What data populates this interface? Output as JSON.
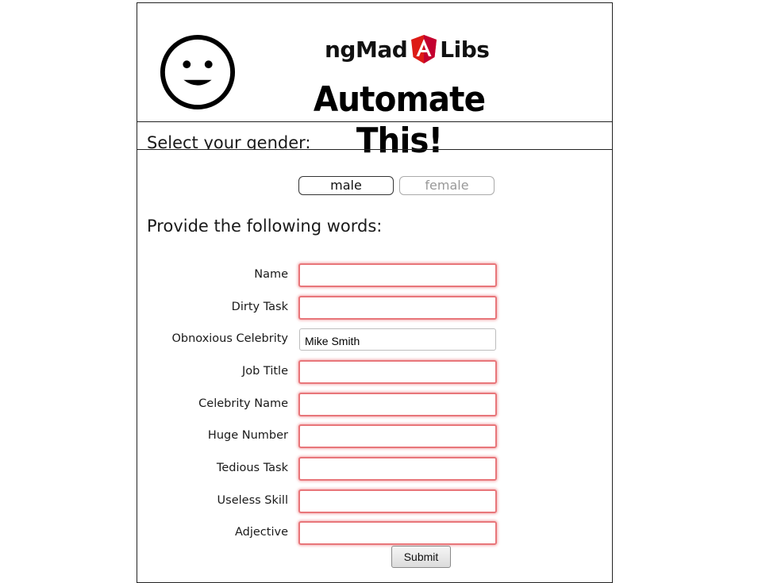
{
  "header": {
    "logo_left": "ngMad",
    "logo_right": "Libs",
    "headline": "Automate This!"
  },
  "gender": {
    "title": "Select your gender:",
    "options": [
      "male",
      "female"
    ],
    "selected": "male"
  },
  "words": {
    "title": "Provide the following words:",
    "fields": [
      {
        "label": "Name",
        "value": "",
        "state": "invalid"
      },
      {
        "label": "Dirty Task",
        "value": "",
        "state": "invalid"
      },
      {
        "label": "Obnoxious Celebrity",
        "value": "Mike Smith",
        "state": "valid"
      },
      {
        "label": "Job Title",
        "value": "",
        "state": "invalid"
      },
      {
        "label": "Celebrity Name",
        "value": "",
        "state": "invalid"
      },
      {
        "label": "Huge Number",
        "value": "",
        "state": "invalid"
      },
      {
        "label": "Tedious Task",
        "value": "",
        "state": "invalid"
      },
      {
        "label": "Useless Skill",
        "value": "",
        "state": "invalid"
      },
      {
        "label": "Adjective",
        "value": "",
        "state": "invalid"
      }
    ]
  },
  "submit_label": "Submit",
  "icons": {
    "smiley": "smiley-face-icon",
    "logo_shield": "angular-shield-icon"
  },
  "colors": {
    "invalid_border": "#e8767a",
    "valid_border": "#bdbdbd",
    "angular_red": "#dd1b16"
  }
}
